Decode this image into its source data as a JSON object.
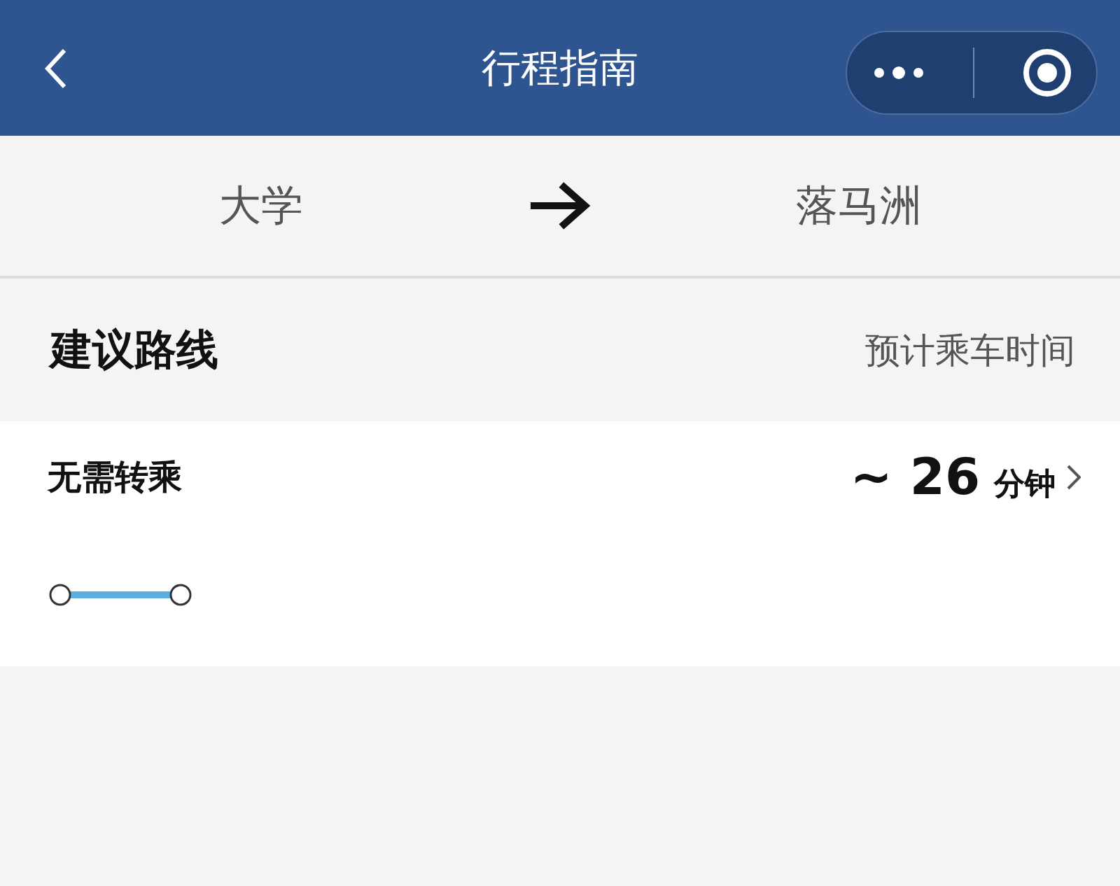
{
  "header": {
    "title": "行程指南"
  },
  "journey": {
    "origin": "大学",
    "destination": "落马洲"
  },
  "section": {
    "title": "建议路线",
    "hint": "预计乘车时间"
  },
  "routes": [
    {
      "title": "无需转乘",
      "duration": "~ 26",
      "unit": "分钟"
    }
  ]
}
